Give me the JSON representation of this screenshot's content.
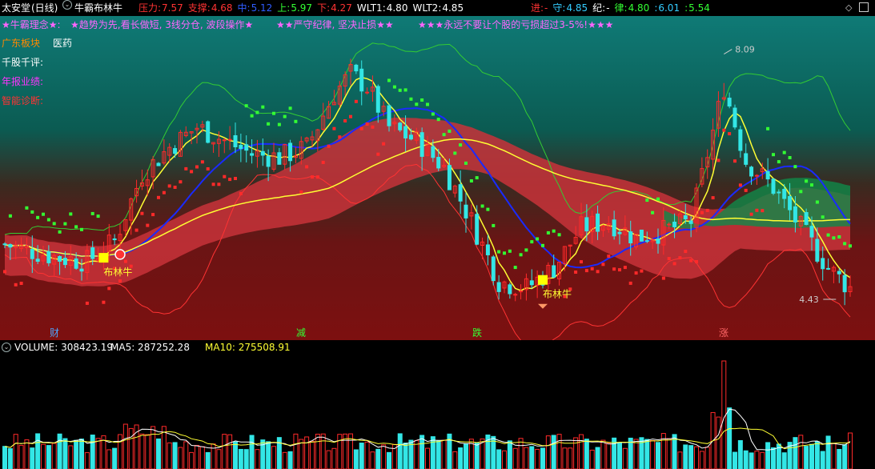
{
  "header": {
    "stock_name": "太安堂",
    "period": "(日线)",
    "indicator_name": "牛霸布林牛",
    "fields": [
      {
        "label": "压力:",
        "value": "7.57",
        "color": "#ff3333",
        "valcolor": "#ff3333"
      },
      {
        "label": "支撑:",
        "value": "4.68",
        "color": "#ff3333",
        "valcolor": "#ff3333"
      },
      {
        "label": "中:",
        "value": "5.12",
        "color": "#2f5cff",
        "valcolor": "#2f5cff"
      },
      {
        "label": "上:",
        "value": "5.97",
        "color": "#33ff33",
        "valcolor": "#33ff33"
      },
      {
        "label": "下:",
        "value": "4.27",
        "color": "#ff3333",
        "valcolor": "#ff3333"
      },
      {
        "label": "WLT1:",
        "value": "4.80",
        "color": "#ffffff",
        "valcolor": "#ffffff"
      },
      {
        "label": "WLT2:",
        "value": "4.85",
        "color": "#ffffff",
        "valcolor": "#ffffff"
      }
    ],
    "right_fields": [
      {
        "label": "进:",
        "value": "-",
        "color": "#ff3333"
      },
      {
        "label": "守:",
        "value": "4.85",
        "color": "#33ccff"
      },
      {
        "label": "纪:",
        "value": "-",
        "color": "#ffffff"
      },
      {
        "label": "律:",
        "value": "4.80",
        "color": "#33ff33"
      },
      {
        "label": ":",
        "value": "6.01",
        "color": "#33ccff"
      },
      {
        "label": ":",
        "value": "5.54",
        "color": "#33ff33"
      }
    ]
  },
  "slogans": [
    "★牛霸理念★:",
    "★趋势为先,看长做短, 3线分仓, 波段操作★",
    "★★严守纪律, 坚决止损★★",
    "★★★永远不要让个股的亏损超过3-5%!★★★"
  ],
  "info_panel": [
    {
      "label": "广东板块",
      "value": "医药",
      "color": "#ff8800"
    },
    {
      "label": "千股千评:",
      "value": "",
      "color": "#ffffff"
    },
    {
      "label": "年报业绩:",
      "value": "",
      "color": "#ff33ff"
    },
    {
      "label": "智能诊断:",
      "value": "",
      "color": "#ff3333"
    }
  ],
  "annotations": {
    "high_label": "8.09",
    "low_label": "4.43",
    "signal_label": "布林牛",
    "bottom_markers": [
      {
        "text": "财",
        "color": "#4da6ff"
      },
      {
        "text": "减",
        "color": "#33ff33"
      },
      {
        "text": "跌",
        "color": "#33ff33"
      },
      {
        "text": "涨",
        "color": "#ff6666"
      }
    ]
  },
  "volume_header": {
    "label": "VOLUME: 308423.19",
    "ma5": "MA5: 287252.28",
    "ma10": "MA10: 275508.91"
  },
  "colors": {
    "up": "#ff2a2a",
    "down": "#33e6e6",
    "ma_yellow": "#ffff33",
    "mid_blue": "#1a2aff",
    "upper_green": "#33cc33",
    "sar_green": "#33ff33",
    "sar_red": "#ff2a2a"
  },
  "chart_data": {
    "type": "candlestick",
    "ylim": [
      4.0,
      8.3
    ],
    "high_marker": 8.09,
    "low_marker": 4.43,
    "anchors": [
      [
        0,
        5.25
      ],
      [
        10,
        5.05
      ],
      [
        15,
        5.0
      ],
      [
        20,
        5.3
      ],
      [
        25,
        6.3
      ],
      [
        30,
        6.7
      ],
      [
        35,
        7.0
      ],
      [
        40,
        6.8
      ],
      [
        45,
        6.6
      ],
      [
        50,
        6.55
      ],
      [
        55,
        6.7
      ],
      [
        60,
        7.5
      ],
      [
        63,
        7.8
      ],
      [
        66,
        7.6
      ],
      [
        70,
        7.0
      ],
      [
        75,
        6.8
      ],
      [
        80,
        6.4
      ],
      [
        85,
        5.6
      ],
      [
        90,
        4.7
      ],
      [
        95,
        4.6
      ],
      [
        100,
        4.9
      ],
      [
        105,
        5.5
      ],
      [
        110,
        5.6
      ],
      [
        115,
        5.35
      ],
      [
        120,
        5.45
      ],
      [
        125,
        5.6
      ],
      [
        128,
        6.6
      ],
      [
        131,
        7.6
      ],
      [
        135,
        6.5
      ],
      [
        140,
        6.1
      ],
      [
        145,
        5.5
      ],
      [
        150,
        4.9
      ],
      [
        154,
        4.6
      ]
    ],
    "candles": 155,
    "series": [
      "price",
      "MA5",
      "Bollinger mid",
      "Bollinger upper",
      "Bollinger lower",
      "SAR",
      "cloud"
    ]
  }
}
